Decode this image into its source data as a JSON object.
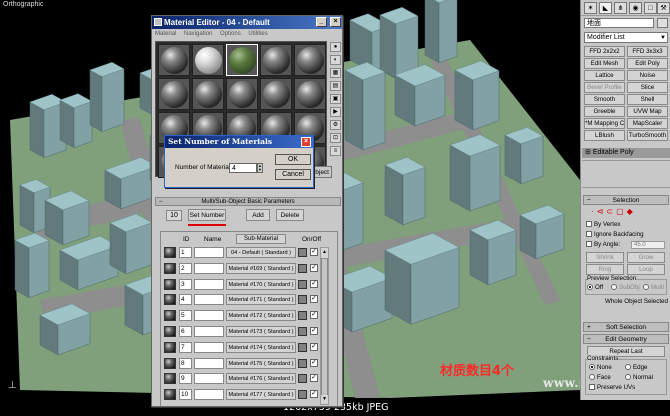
{
  "viewport": {
    "label": "Orthographic",
    "caption": "材质数目4个",
    "watermark": "www.snren.com"
  },
  "image_info": "1262x759  235kb  JPEG",
  "command_panel": {
    "object_name": "地面",
    "modifier_list": "Modifier List",
    "modifier_buttons": [
      {
        "label": "FFD 2x2x2",
        "enabled": true
      },
      {
        "label": "FFD 3x3x3",
        "enabled": true
      },
      {
        "label": "Edit Mesh",
        "enabled": true
      },
      {
        "label": "Edit Poly",
        "enabled": true
      },
      {
        "label": "Lattice",
        "enabled": true
      },
      {
        "label": "Noise",
        "enabled": true
      },
      {
        "label": "Bevel Profile",
        "enabled": false
      },
      {
        "label": "Slice",
        "enabled": true
      },
      {
        "label": "Smooth",
        "enabled": true
      },
      {
        "label": "Shell",
        "enabled": true
      },
      {
        "label": "Greeble",
        "enabled": true
      },
      {
        "label": "UVW Map",
        "enabled": true
      },
      {
        "label": "*M Mapping Cl",
        "enabled": true
      },
      {
        "label": "MapScaler",
        "enabled": true
      },
      {
        "label": "LBlush",
        "enabled": true
      },
      {
        "label": "TurboSmooth",
        "enabled": true
      }
    ],
    "stack_item": "Editable Poly",
    "selection": {
      "title": "Selection",
      "by_vertex": "By Vertex",
      "ignore_backfacing": "Ignore Backfacing",
      "by_angle": "By Angle:",
      "angle_value": "45.0",
      "shrink": "Shrink",
      "grow": "Grow",
      "ring": "Ring",
      "loop": "Loop",
      "preview_selection": "Preview Selection",
      "preview_off": "Off",
      "preview_subobj": "SubObj",
      "preview_multi": "Multi",
      "status": "Whole Object Selected"
    },
    "soft_selection": "Soft Selection",
    "edit_geometry": "Edit Geometry",
    "repeat_last": "Repeat Last",
    "constraints": {
      "title": "Constraints",
      "none": "None",
      "edge": "Edge",
      "face": "Face",
      "normal": "Normal",
      "preserve_uvs": "Preserve UVs"
    }
  },
  "material_editor": {
    "title": "Material Editor - 04 - Default",
    "menu": [
      "Material",
      "Navigation",
      "Options",
      "Utilities"
    ],
    "object_type": "Object",
    "rollout_title": "Multi/Sub-Object Basic Parameters",
    "material_count": "10",
    "set_number_label": "Set Number",
    "add_label": "Add",
    "delete_label": "Delete",
    "list_headers": {
      "id": "ID",
      "name": "Name",
      "submaterial": "Sub-Material",
      "onoff": "On/Off"
    },
    "rows": [
      {
        "id": "1",
        "sub": "04 - Default  ( Standard )"
      },
      {
        "id": "2",
        "sub": "Material #169  ( Standard )"
      },
      {
        "id": "3",
        "sub": "Material #170  ( Standard )"
      },
      {
        "id": "4",
        "sub": "Material #171  ( Standard )"
      },
      {
        "id": "5",
        "sub": "Material #172  ( Standard )"
      },
      {
        "id": "6",
        "sub": "Material #173  ( Standard )"
      },
      {
        "id": "7",
        "sub": "Material #174  ( Standard )"
      },
      {
        "id": "8",
        "sub": "Material #175  ( Standard )"
      },
      {
        "id": "9",
        "sub": "Material #176  ( Standard )"
      },
      {
        "id": "10",
        "sub": "Material #177  ( Standard )"
      }
    ]
  },
  "dialog": {
    "title": "Set Number of Materials",
    "label": "Number of Materials:",
    "value": "4",
    "ok": "OK",
    "cancel": "Cancel"
  },
  "colors": {
    "titlebar": "#0a246a",
    "ground": "#7fa07a",
    "road": "#8e8e8e",
    "building": "#9ec4c8",
    "caption": "#ff2a2a"
  }
}
